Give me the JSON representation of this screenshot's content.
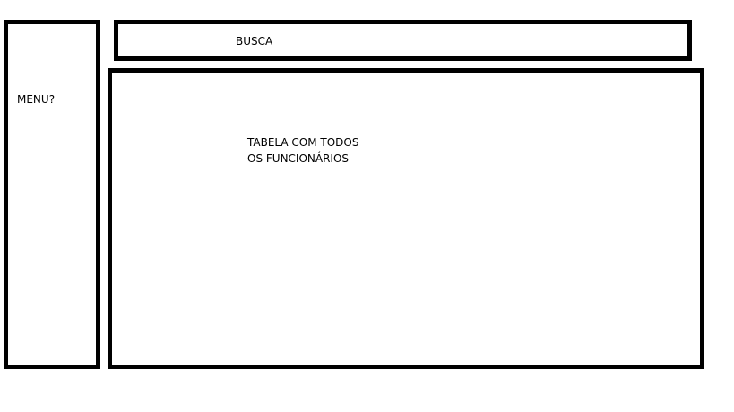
{
  "sidebar": {
    "label": "MENU?"
  },
  "search": {
    "label": "BUSCA"
  },
  "main": {
    "table_label_line1": "TABELA COM TODOS",
    "table_label_line2": "OS FUNCIONÁRIOS"
  },
  "colors": {
    "border": "#000000",
    "background": "#ffffff"
  }
}
